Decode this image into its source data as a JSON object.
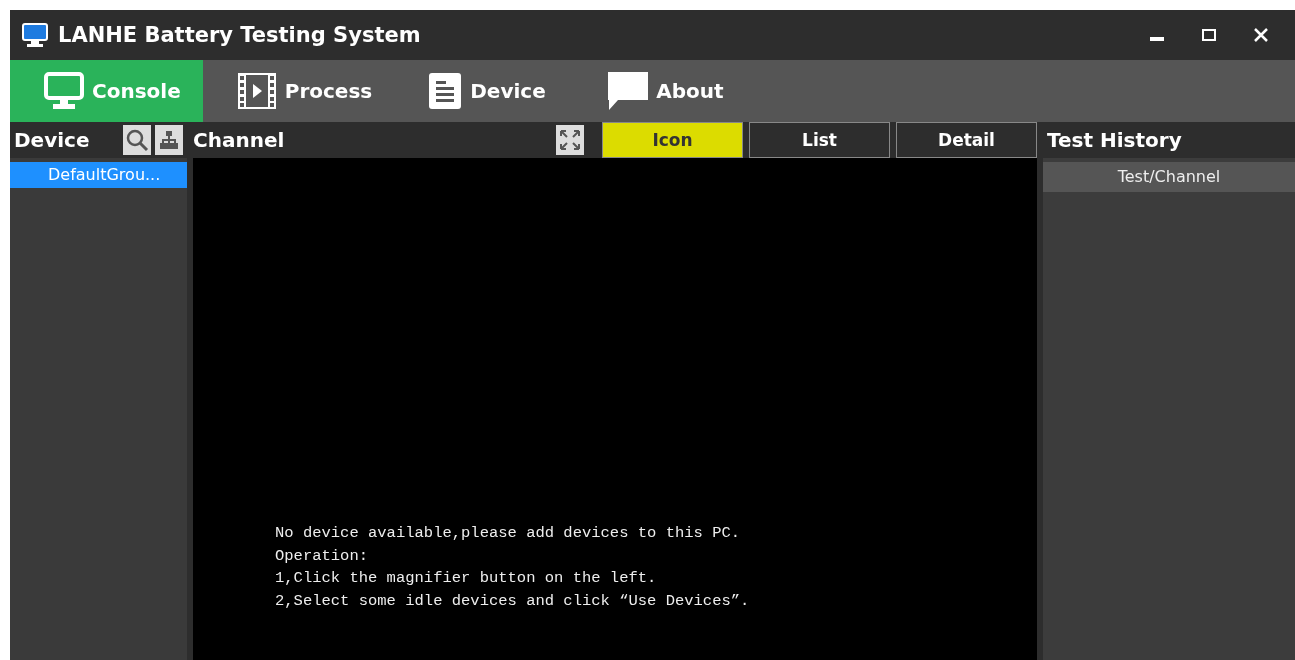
{
  "window": {
    "title": "LANHE Battery Testing System"
  },
  "nav_tabs": [
    {
      "label": "Console",
      "kind": "monitor",
      "selected": true
    },
    {
      "label": "Process",
      "kind": "film",
      "selected": false
    },
    {
      "label": "Device",
      "kind": "document",
      "selected": false
    },
    {
      "label": "About",
      "kind": "speech",
      "selected": false
    }
  ],
  "device_panel": {
    "title": "Device",
    "items": [
      {
        "label": "DefaultGrou...",
        "selected": true
      }
    ]
  },
  "channel_panel": {
    "title": "Channel",
    "view_tabs": [
      {
        "label": "Icon",
        "selected": true
      },
      {
        "label": "List",
        "selected": false
      },
      {
        "label": "Detail",
        "selected": false
      }
    ],
    "message_lines": [
      "No device available,please add devices to this PC.",
      "Operation:",
      "1,Click the magnifier button on the left.",
      "2,Select some idle devices and click “Use Devices”."
    ]
  },
  "history_panel": {
    "title": "Test History",
    "column": "Test/Channel"
  }
}
